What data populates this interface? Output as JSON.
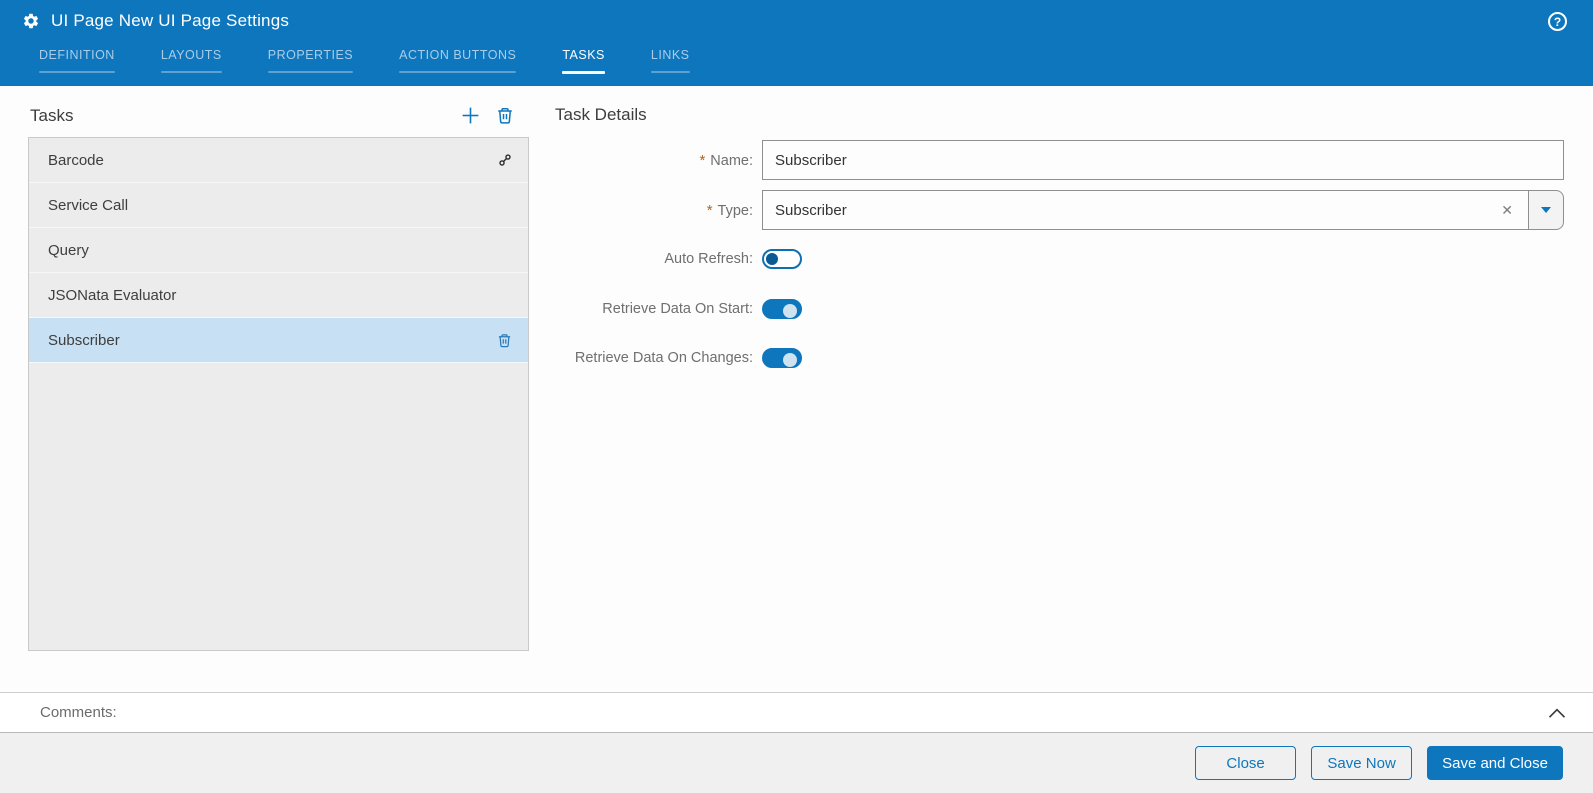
{
  "window": {
    "title": "UI Page New UI Page Settings",
    "help_glyph": "?"
  },
  "tabs": [
    {
      "label": "DEFINITION",
      "active": false
    },
    {
      "label": "LAYOUTS",
      "active": false
    },
    {
      "label": "PROPERTIES",
      "active": false
    },
    {
      "label": "ACTION BUTTONS",
      "active": false
    },
    {
      "label": "TASKS",
      "active": true
    },
    {
      "label": "LINKS",
      "active": false
    }
  ],
  "tasks_panel": {
    "title": "Tasks",
    "items": [
      {
        "label": "Barcode",
        "selected": false,
        "trailing_icon": "link-icon"
      },
      {
        "label": "Service Call",
        "selected": false,
        "trailing_icon": ""
      },
      {
        "label": "Query",
        "selected": false,
        "trailing_icon": ""
      },
      {
        "label": "JSONata Evaluator",
        "selected": false,
        "trailing_icon": ""
      },
      {
        "label": "Subscriber",
        "selected": true,
        "trailing_icon": "trash-icon"
      }
    ]
  },
  "task_details": {
    "title": "Task Details",
    "name": {
      "label": "Name:",
      "required_marker": "*",
      "value": "Subscriber"
    },
    "type": {
      "label": "Type:",
      "required_marker": "*",
      "value": "Subscriber",
      "clear_glyph": "✕"
    },
    "auto_refresh": {
      "label": "Auto Refresh:",
      "on": false
    },
    "retrieve_data_on_start": {
      "label": "Retrieve Data On Start:",
      "on": true
    },
    "retrieve_data_on_changes": {
      "label": "Retrieve Data On Changes:",
      "on": true
    }
  },
  "comments": {
    "label": "Comments:"
  },
  "footer": {
    "buttons": [
      {
        "label": "Close",
        "primary": false
      },
      {
        "label": "Save Now",
        "primary": false
      },
      {
        "label": "Save and Close",
        "primary": true
      }
    ]
  },
  "colors": {
    "header_blue": "#0e76bd",
    "accent_blue": "#0e76bd",
    "selected_row_blue": "#c7e0f3",
    "required_asterisk": "#b2641f",
    "row_gray": "#ececec",
    "footer_gray": "#f0f0f0"
  }
}
